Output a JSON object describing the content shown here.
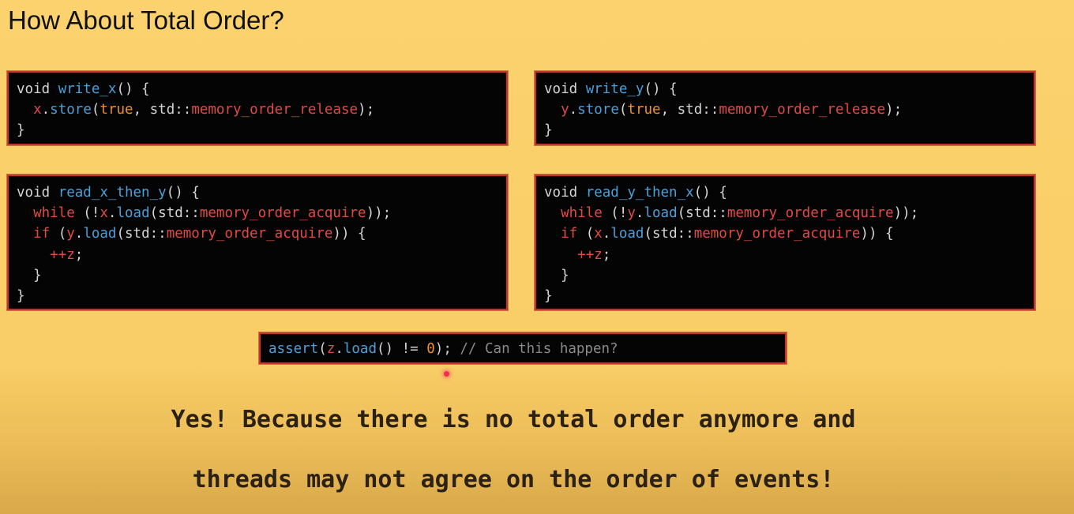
{
  "slide": {
    "title": "How About Total Order?"
  },
  "code": {
    "write_x": [
      [
        [
          "kw",
          "void "
        ],
        [
          "fn",
          "write_x"
        ],
        [
          "kw",
          "() {"
        ]
      ],
      [
        [
          "kw",
          "  "
        ],
        [
          "var",
          "x"
        ],
        [
          "kw",
          "."
        ],
        [
          "fn",
          "store"
        ],
        [
          "kw",
          "("
        ],
        [
          "lit",
          "true"
        ],
        [
          "kw",
          ", std::"
        ],
        [
          "var",
          "memory_order_release"
        ],
        [
          "kw",
          ");"
        ]
      ],
      [
        [
          "kw",
          "}"
        ]
      ]
    ],
    "write_y": [
      [
        [
          "kw",
          "void "
        ],
        [
          "fn",
          "write_y"
        ],
        [
          "kw",
          "() {"
        ]
      ],
      [
        [
          "kw",
          "  "
        ],
        [
          "var",
          "y"
        ],
        [
          "kw",
          "."
        ],
        [
          "fn",
          "store"
        ],
        [
          "kw",
          "("
        ],
        [
          "lit",
          "true"
        ],
        [
          "kw",
          ", std::"
        ],
        [
          "var",
          "memory_order_release"
        ],
        [
          "kw",
          ");"
        ]
      ],
      [
        [
          "kw",
          "}"
        ]
      ]
    ],
    "read_x_then_y": [
      [
        [
          "kw",
          "void "
        ],
        [
          "fn",
          "read_x_then_y"
        ],
        [
          "kw",
          "() {"
        ]
      ],
      [
        [
          "kw",
          "  "
        ],
        [
          "var",
          "while"
        ],
        [
          "kw",
          " (!"
        ],
        [
          "var",
          "x"
        ],
        [
          "kw",
          "."
        ],
        [
          "fn",
          "load"
        ],
        [
          "kw",
          "(std::"
        ],
        [
          "var",
          "memory_order_acquire"
        ],
        [
          "kw",
          "));"
        ]
      ],
      [
        [
          "kw",
          "  "
        ],
        [
          "var",
          "if"
        ],
        [
          "kw",
          " ("
        ],
        [
          "var",
          "y"
        ],
        [
          "kw",
          "."
        ],
        [
          "fn",
          "load"
        ],
        [
          "kw",
          "(std::"
        ],
        [
          "var",
          "memory_order_acquire"
        ],
        [
          "kw",
          ")) {"
        ]
      ],
      [
        [
          "kw",
          "    "
        ],
        [
          "var",
          "++z"
        ],
        [
          "kw",
          ";"
        ]
      ],
      [
        [
          "kw",
          "  }"
        ]
      ],
      [
        [
          "kw",
          "}"
        ]
      ]
    ],
    "read_y_then_x": [
      [
        [
          "kw",
          "void "
        ],
        [
          "fn",
          "read_y_then_x"
        ],
        [
          "kw",
          "() {"
        ]
      ],
      [
        [
          "kw",
          "  "
        ],
        [
          "var",
          "while"
        ],
        [
          "kw",
          " (!"
        ],
        [
          "var",
          "y"
        ],
        [
          "kw",
          "."
        ],
        [
          "fn",
          "load"
        ],
        [
          "kw",
          "(std::"
        ],
        [
          "var",
          "memory_order_acquire"
        ],
        [
          "kw",
          "));"
        ]
      ],
      [
        [
          "kw",
          "  "
        ],
        [
          "var",
          "if"
        ],
        [
          "kw",
          " ("
        ],
        [
          "var",
          "x"
        ],
        [
          "kw",
          "."
        ],
        [
          "fn",
          "load"
        ],
        [
          "kw",
          "(std::"
        ],
        [
          "var",
          "memory_order_acquire"
        ],
        [
          "kw",
          ")) {"
        ]
      ],
      [
        [
          "kw",
          "    "
        ],
        [
          "var",
          "++z"
        ],
        [
          "kw",
          ";"
        ]
      ],
      [
        [
          "kw",
          "  }"
        ]
      ],
      [
        [
          "kw",
          "}"
        ]
      ]
    ],
    "assert": [
      [
        [
          "fn",
          "assert"
        ],
        [
          "kw",
          "("
        ],
        [
          "var",
          "z"
        ],
        [
          "kw",
          "."
        ],
        [
          "fn",
          "load"
        ],
        [
          "kw",
          "() != "
        ],
        [
          "lit",
          "0"
        ],
        [
          "kw",
          "); "
        ],
        [
          "cm",
          "// Can this happen?"
        ]
      ]
    ]
  },
  "answer": {
    "line1": "Yes! Because there is no total order anymore and",
    "line2": "threads may not agree on the order of events!"
  },
  "colors": {
    "background": "#fbd26e",
    "code_background": "#050404",
    "code_border": "#c8322e",
    "keyword_default": "#d5d5d5",
    "function_blue": "#4aa0da",
    "variable_red": "#e04a45",
    "literal_orange": "#ef8f2e",
    "comment_gray": "#8a8a8a",
    "laser_pointer": "#ef2f52"
  }
}
